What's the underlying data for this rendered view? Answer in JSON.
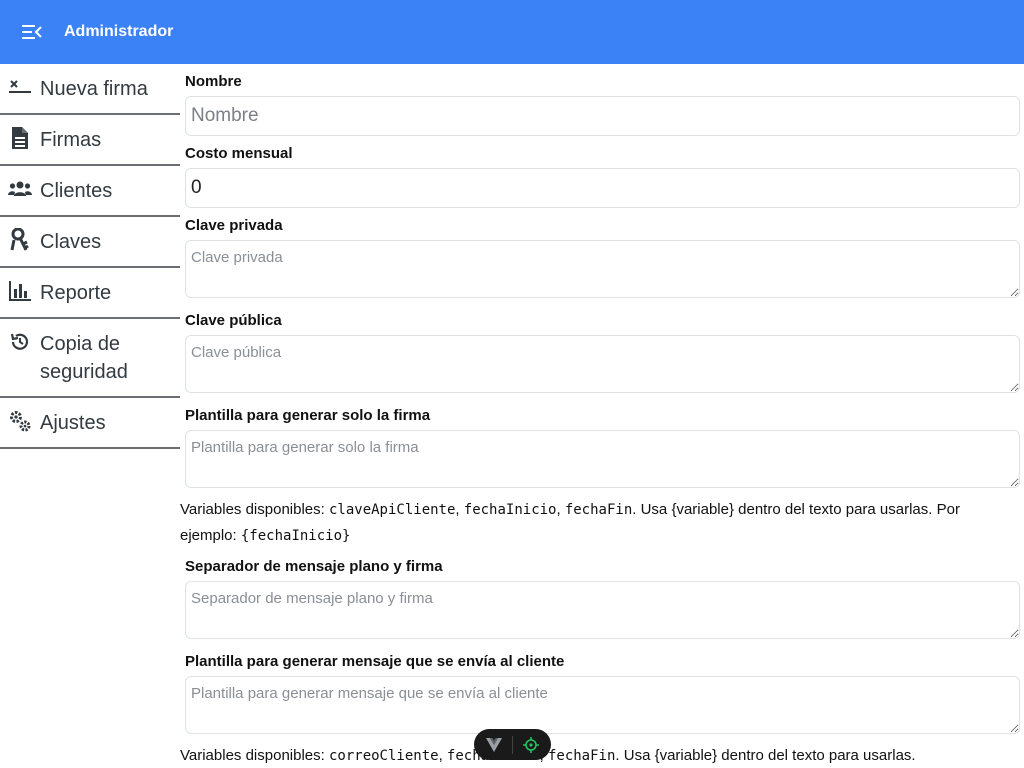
{
  "header": {
    "title": "Administrador",
    "menu_icon": "menu-collapse-icon"
  },
  "sidebar": {
    "items": [
      {
        "label": "Nueva firma",
        "icon": "signature-icon"
      },
      {
        "label": "Firmas",
        "icon": "document-icon"
      },
      {
        "label": "Clientes",
        "icon": "users-icon"
      },
      {
        "label": "Claves",
        "icon": "key-icon"
      },
      {
        "label": "Reporte",
        "icon": "bar-chart-icon"
      },
      {
        "label": "Copia de seguridad",
        "icon": "history-icon"
      },
      {
        "label": "Ajustes",
        "icon": "gears-icon"
      }
    ]
  },
  "form": {
    "nombre": {
      "label": "Nombre",
      "placeholder": "Nombre",
      "value": ""
    },
    "costo": {
      "label": "Costo mensual",
      "value": "0"
    },
    "clave_privada": {
      "label": "Clave privada",
      "placeholder": "Clave privada"
    },
    "clave_publica": {
      "label": "Clave pública",
      "placeholder": "Clave pública"
    },
    "plantilla_firma": {
      "label": "Plantilla para generar solo la firma",
      "placeholder": "Plantilla para generar solo la firma"
    },
    "help1": {
      "prefix": "Variables disponibles: ",
      "var1": "claveApiCliente",
      "sep1": ", ",
      "var2": "fechaInicio",
      "sep2": ", ",
      "var3": "fechaFin",
      "suffix": ". Usa {variable} dentro del texto para usarlas. Por ejemplo: ",
      "example": "{fechaInicio}"
    },
    "separador": {
      "label": "Separador de mensaje plano y firma",
      "placeholder": "Separador de mensaje plano y firma"
    },
    "plantilla_mensaje": {
      "label": "Plantilla para generar mensaje que se envía al cliente",
      "placeholder": "Plantilla para generar mensaje que se envía al cliente"
    },
    "help2": {
      "prefix": "Variables disponibles: ",
      "var1": "correoCliente",
      "sep1": ", ",
      "var2": "fechaInicio",
      "sep2": ", ",
      "var3": "fechaFin",
      "suffix": ". Usa {variable} dentro del texto para usarlas."
    }
  },
  "toolbar": {
    "left_icon": "vue-logo-icon",
    "right_icon": "crosshair-icon"
  },
  "colors": {
    "header_bg": "#3b82f6",
    "sidebar_text": "#333a40",
    "toolbar_accent": "#22c55e"
  }
}
